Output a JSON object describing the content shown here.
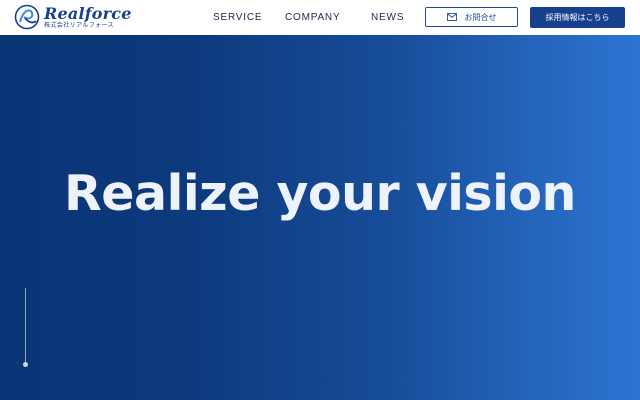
{
  "header": {
    "logo": {
      "name": "Realforce",
      "subtitle": "株式会社リアルフォース",
      "mark_icon": "realforce-logo-mark"
    },
    "nav": [
      {
        "label": "SERVICE"
      },
      {
        "label": "COMPANY"
      },
      {
        "label": "NEWS"
      }
    ],
    "contact_button": {
      "label": "お問合せ",
      "icon": "mail-icon"
    },
    "recruit_button": {
      "label": "採用情報はこちら"
    }
  },
  "hero": {
    "headline": "Realize your vision"
  },
  "colors": {
    "brand": "#17408e",
    "hero_gradient_start": "#0a3576",
    "hero_gradient_end": "#2c74d2",
    "headline": "#eef3fb"
  }
}
